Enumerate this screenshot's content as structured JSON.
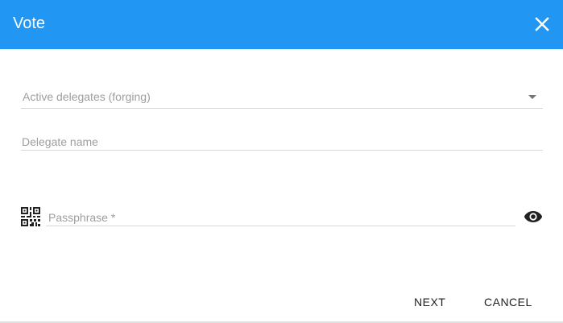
{
  "dialog": {
    "title": "Vote",
    "close_icon": "close-icon"
  },
  "form": {
    "delegates_select": {
      "label": "Active delegates (forging)",
      "icon": "dropdown-arrow-icon"
    },
    "delegate_name": {
      "label": "Delegate name"
    },
    "passphrase": {
      "label": "Passphrase *",
      "left_icon": "qr-code-icon",
      "right_icon": "eye-icon"
    }
  },
  "actions": {
    "next_label": "NEXT",
    "cancel_label": "CANCEL"
  },
  "colors": {
    "header": "#2196f3",
    "label": "#9e9e9e",
    "underline": "#d8d8d8"
  }
}
